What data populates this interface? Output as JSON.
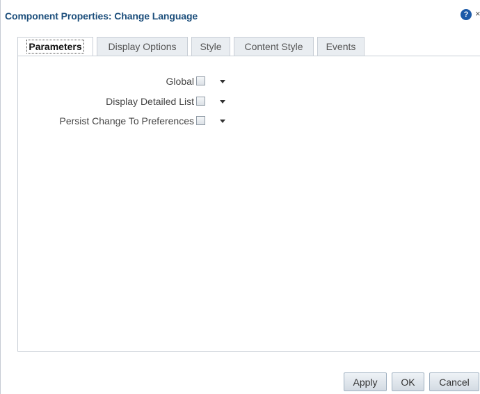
{
  "dialog": {
    "title": "Component Properties: Change Language",
    "help_icon_glyph": "?",
    "close_icon_glyph": "×"
  },
  "tabs": [
    {
      "label": "Parameters",
      "active": true
    },
    {
      "label": "Display Options",
      "active": false
    },
    {
      "label": "Style",
      "active": false
    },
    {
      "label": "Content Style",
      "active": false
    },
    {
      "label": "Events",
      "active": false
    }
  ],
  "parameters": [
    {
      "label": "Global",
      "checked": false
    },
    {
      "label": "Display Detailed List",
      "checked": false
    },
    {
      "label": "Persist Change To Preferences",
      "checked": false
    }
  ],
  "buttons": {
    "apply": "Apply",
    "ok": "OK",
    "cancel": "Cancel"
  },
  "colors": {
    "title": "#1d4f7c",
    "help_icon": "#1b5aa8",
    "tab_inactive_bg": "#e9edf1",
    "border": "#c8ced6"
  }
}
